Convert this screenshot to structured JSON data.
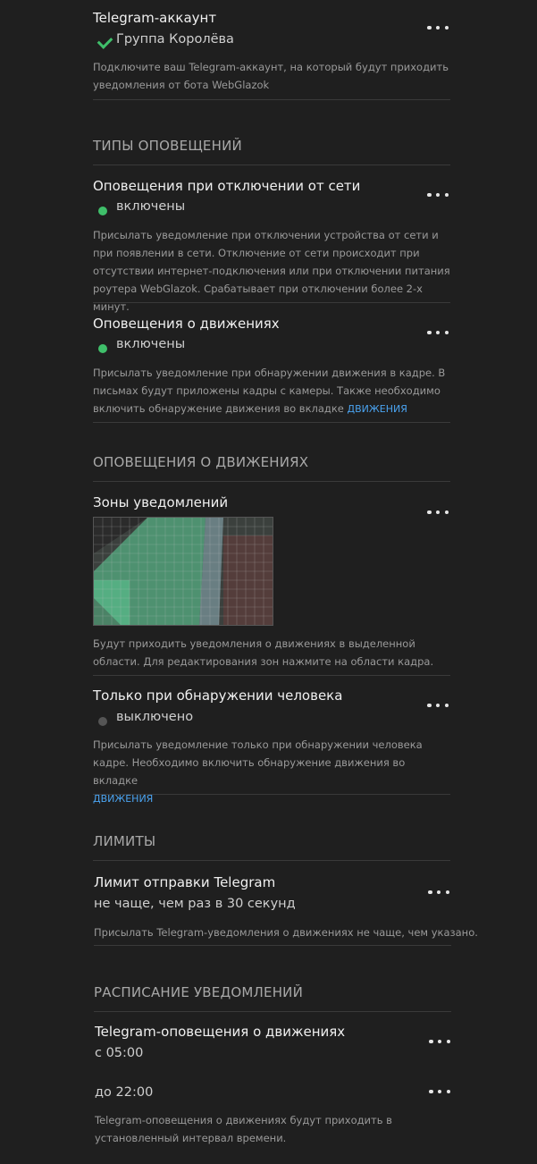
{
  "telegram": {
    "title": "Telegram-аккаунт",
    "value": "Группа Королёва",
    "desc": "Подключите ваш Telegram-аккаунт, на который будут приходить уведомления от бота WebGlazok"
  },
  "section_types": "ТИПЫ ОПОВЕЩЕНИЙ",
  "network": {
    "title": "Оповещения при отключении от сети",
    "value": "включены",
    "desc": "Присылать уведомление при отключении устройства от сети и при появлении в сети. Отключение от сети происходит при отсутствии интернет-подключения или при отключении питания роутера WebGlazok. Срабатывает при отключении более 2-х минут."
  },
  "motion": {
    "title": "Оповещения о движениях",
    "value": "включены",
    "desc": "Присылать уведомление при обнаружении движения в кадре. В письмах будут приложены кадры с камеры. Также необходимо включить обнаружение движения во вкладке",
    "link": "ДВИЖЕНИЯ"
  },
  "section_motion": "ОПОВЕЩЕНИЯ О ДВИЖЕНИЯХ",
  "zones": {
    "title": "Зоны уведомлений",
    "desc": "Будут приходить уведомления о движениях в выделенной области. Для редактирования зон нажмите на области кадра."
  },
  "human": {
    "title": "Только при обнаружении человека",
    "value": "выключено",
    "desc": "Присылать уведомление только при обнаружении человека кадре. Необходимо включить обнаружение движения во вкладке",
    "link": "ДВИЖЕНИЯ"
  },
  "section_limits": "ЛИМИТЫ",
  "limit": {
    "title": "Лимит отправки Telegram",
    "value": "не чаще, чем раз в 30 секунд",
    "desc": "Присылать Telegram-уведомления о движениях не чаще, чем указано."
  },
  "section_schedule": "РАСПИСАНИЕ УВЕДОМЛЕНИЙ",
  "schedule": {
    "title": "Telegram-оповещения о движениях",
    "from": "с 05:00",
    "to": "до 22:00",
    "desc": "Telegram-оповещения о движениях будут приходить в установленный интервал времени."
  },
  "colors": {
    "on": "#3fbf6a",
    "off": "#555555",
    "link": "#4aa3f0",
    "zone": "#5fd39a"
  }
}
